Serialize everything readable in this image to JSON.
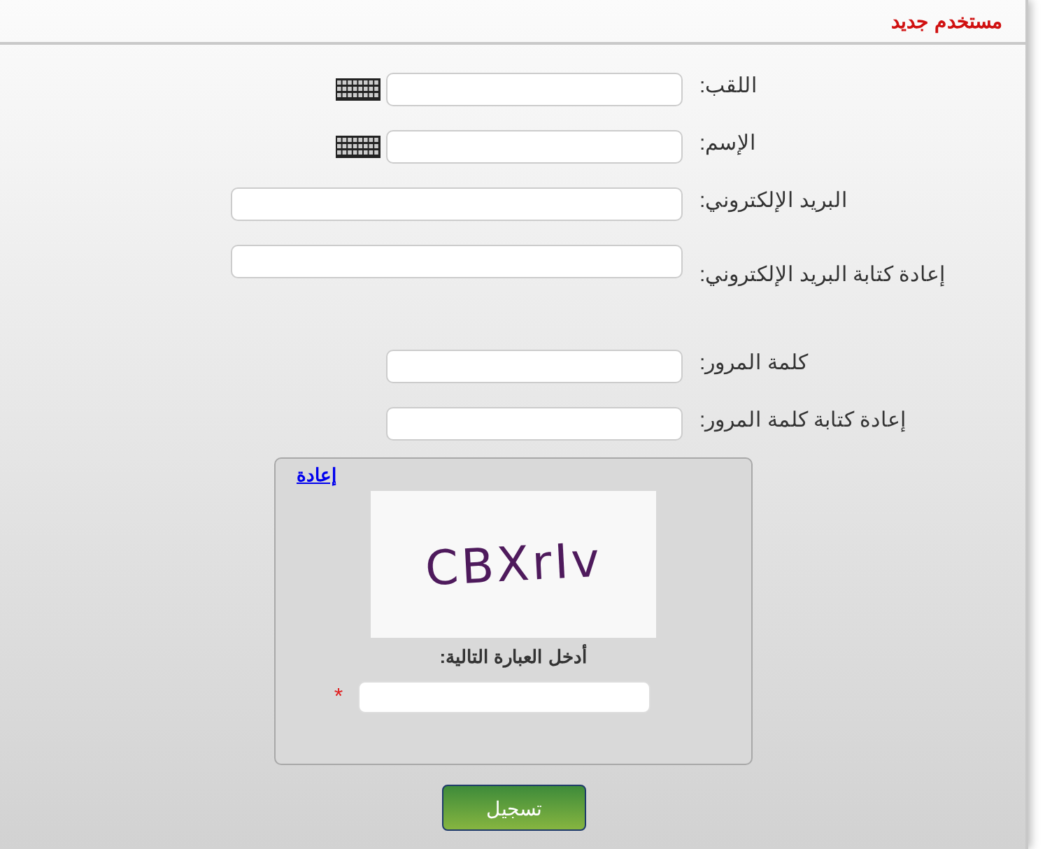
{
  "header": {
    "title": "مستخدم جديد"
  },
  "fields": [
    {
      "label": "اللقب:",
      "kind": "keyboard"
    },
    {
      "label": "الإسم:",
      "kind": "keyboard"
    },
    {
      "label": "البريد الإلكتروني:",
      "kind": "wide"
    },
    {
      "label": "إعادة كتابة البريد الإلكتروني:",
      "kind": "wide_low"
    },
    {
      "label": "كلمة المرور:",
      "kind": "short"
    },
    {
      "label": "إعادة كتابة كلمة المرور:",
      "kind": "short"
    }
  ],
  "captcha": {
    "refresh_link": "إعادة",
    "image_text": "CBXrIv",
    "instruction": "أدخل العبارة التالية:",
    "required_mark": "*"
  },
  "submit_button": "تسجيل"
}
